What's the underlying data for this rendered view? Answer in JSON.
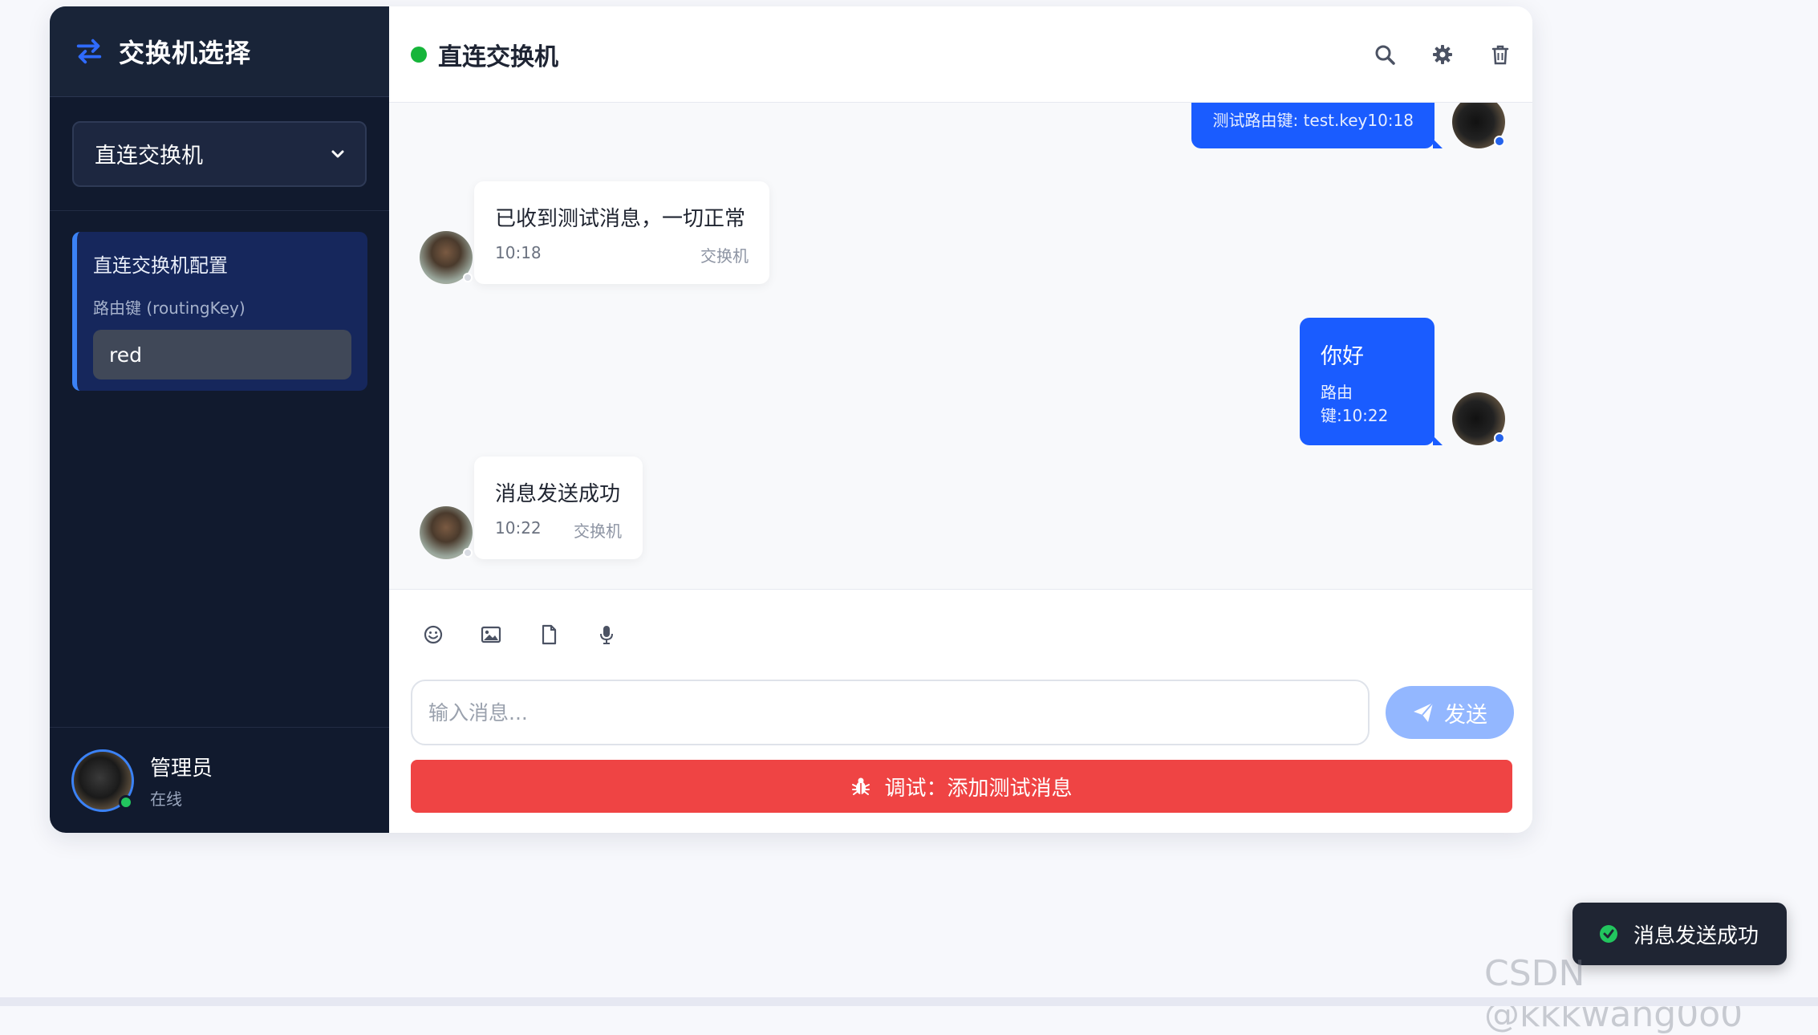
{
  "sidebar": {
    "title": "交换机选择",
    "selected_exchange": "直连交换机",
    "config": {
      "title": "直连交换机配置",
      "routing_key_label": "路由键 (routingKey)",
      "routing_key_value": "red"
    },
    "user": {
      "name": "管理员",
      "status": "在线"
    }
  },
  "chat": {
    "title": "直连交换机",
    "messages": [
      {
        "direction": "out",
        "text": "",
        "meta": "测试路由键: test.key10:18"
      },
      {
        "direction": "in",
        "text": "已收到测试消息，一切正常",
        "time": "10:18",
        "from": "交换机"
      },
      {
        "direction": "out",
        "text": "你好",
        "meta": "路由键:10:22"
      },
      {
        "direction": "in",
        "text": "消息发送成功",
        "time": "10:22",
        "from": "交换机"
      }
    ]
  },
  "composer": {
    "placeholder": "输入消息...",
    "send_label": "发送",
    "debug_label": "调试：添加测试消息"
  },
  "toast": {
    "text": "消息发送成功"
  },
  "watermark": "CSDN @kkkwang0o0",
  "colors": {
    "sidebar_bg": "#111a2e",
    "accent": "#1a5cff",
    "online": "#16b53a",
    "danger": "#ef4444"
  }
}
